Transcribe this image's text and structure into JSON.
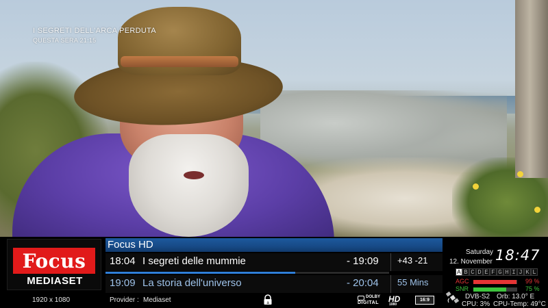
{
  "video": {
    "promo_title": "I SEGRETI DELL'ARCA PERDUTA",
    "promo_time": "QUESTA SERA 21:15"
  },
  "channel": {
    "logo_text": "Focus",
    "logo_sub": "MEDIASET",
    "name": "Focus HD",
    "resolution": "1920 x 1080",
    "provider_label": "Provider :",
    "provider": "Mediaset"
  },
  "events": {
    "now": {
      "start": "18:04",
      "title": "I segreti delle mummie",
      "end": "- 19:09",
      "info": "+43  -21",
      "progress": 0.67
    },
    "next": {
      "start": "19:09",
      "title": "La storia dell'universo",
      "end": "- 20:04",
      "info": "55 Mins"
    }
  },
  "clock": {
    "day": "Saturday",
    "date": "12. November",
    "time": "18:47"
  },
  "letters": [
    "A",
    "B",
    "C",
    "D",
    "E",
    "F",
    "G",
    "H",
    "I",
    "J",
    "K",
    "L"
  ],
  "active_letter": 0,
  "signal": {
    "agc_label": "AGC",
    "agc_value": "99 %",
    "agc_level": 0.99,
    "agc_color": "#e53535",
    "snr_label": "SNR",
    "snr_value": "75 %",
    "snr_level": 0.75,
    "snr_color": "#3ec43e"
  },
  "tuner": {
    "system": "DVB-S2",
    "orbit": "Orb:  13.0° E",
    "cpu": "CPU:  3%",
    "cpu_temp": "CPU-Temp: 49°C"
  },
  "badges": {
    "dolby_top": "DOLBY",
    "dolby_bottom": "DIGITAL",
    "hd": "HD",
    "hd_sub": "1080",
    "aspect": "16:9"
  },
  "icons": {
    "lock": "lock-icon",
    "satellite": "satellite-icon"
  }
}
